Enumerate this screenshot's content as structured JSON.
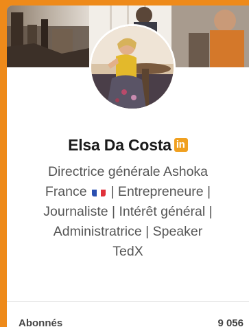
{
  "profile": {
    "name": "Elsa Da Costa",
    "badge_text": "in",
    "headline_line1": "Directrice générale Ashoka",
    "headline_line2_pre": "France",
    "headline_line2_post": "| Entrepreneure |",
    "headline_line3": "Journaliste | Intérêt général |",
    "headline_line4": "Administratrice | Speaker",
    "headline_line5": "TedX"
  },
  "stats": {
    "followers_label": "Abonnés",
    "followers_value": "9 056"
  },
  "colors": {
    "frame": "#ee8a1a",
    "badge": "#f0a020",
    "flag_blue": "#2a4fb0",
    "flag_white": "#ffffff",
    "flag_red": "#e0313a"
  },
  "icons": {
    "badge_icon": "linkedin-icon",
    "flag_icon": "france-flag-icon"
  }
}
